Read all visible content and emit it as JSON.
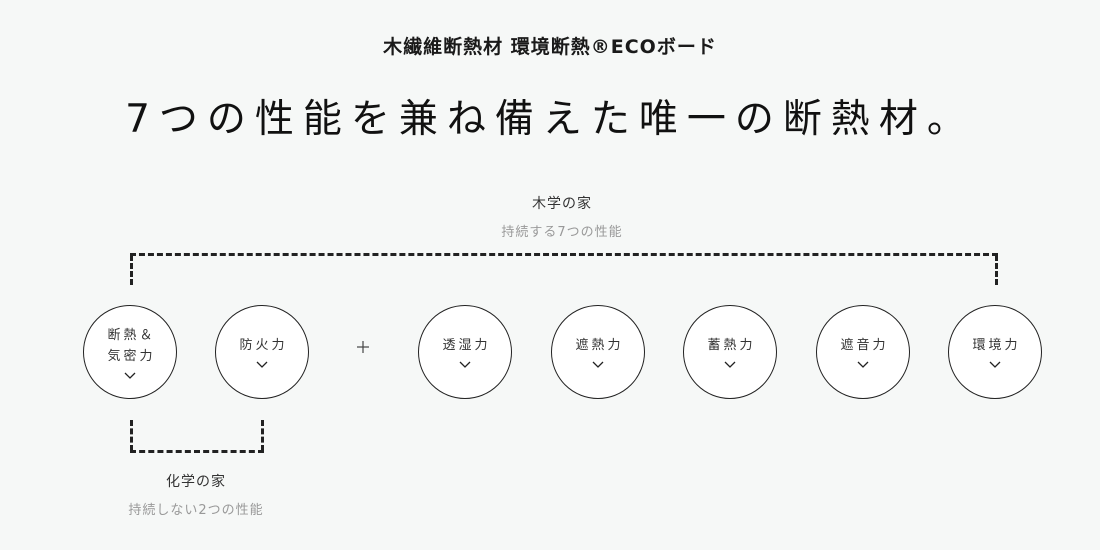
{
  "header": {
    "subheading": "木繊維断熱材 環境断熱®ECOボード",
    "headline": "7つの性能を兼ね備えた唯一の断熱材。"
  },
  "groups": {
    "wood": {
      "title": "木学の家",
      "subtitle": "持続する7つの性能"
    },
    "chemical": {
      "title": "化学の家",
      "subtitle": "持続しない2つの性能"
    }
  },
  "connector_symbol": "plus-icon",
  "performances": [
    {
      "label": "断熱＆\n気密力",
      "icon": "chevron-down-icon"
    },
    {
      "label": "防火力",
      "icon": "chevron-down-icon"
    },
    {
      "label": "透湿力",
      "icon": "chevron-down-icon"
    },
    {
      "label": "遮熱力",
      "icon": "chevron-down-icon"
    },
    {
      "label": "蓄熱力",
      "icon": "chevron-down-icon"
    },
    {
      "label": "遮音力",
      "icon": "chevron-down-icon"
    },
    {
      "label": "環境力",
      "icon": "chevron-down-icon"
    }
  ],
  "colors": {
    "background": "#f6f8f7",
    "line": "#222222",
    "muted_text": "#999999"
  }
}
